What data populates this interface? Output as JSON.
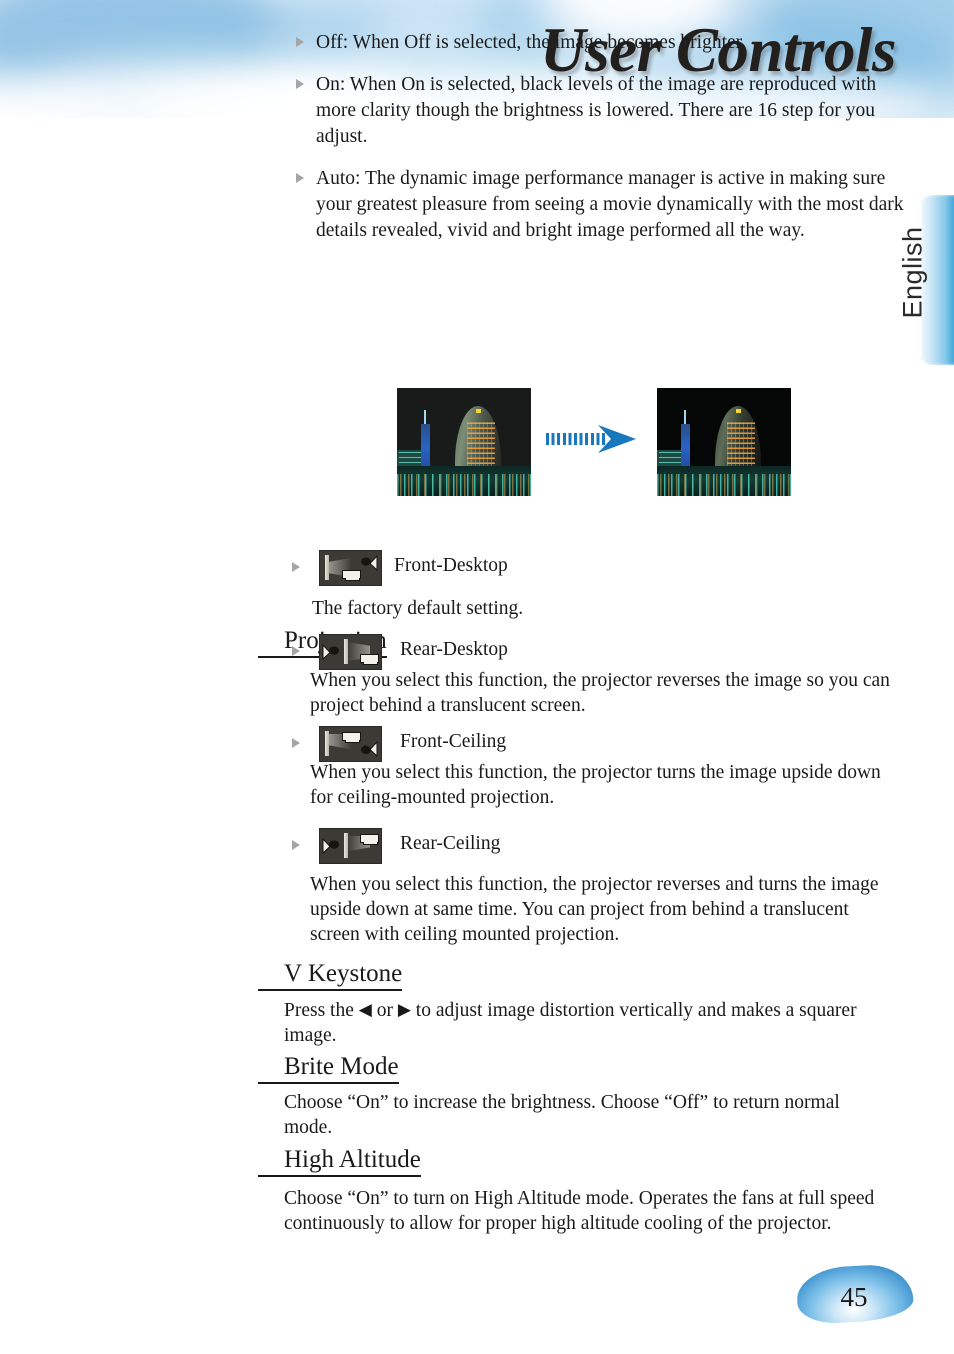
{
  "header": {
    "title": "User Controls"
  },
  "side_tab": {
    "label": "English"
  },
  "intro_bullets": [
    {
      "text": "Off: When Off is selected, the image becomes brighter."
    },
    {
      "text": "On: When On is selected, black levels of the image are reproduced with more clarity though the brightness is lowered. There are 16 step for you adjust."
    },
    {
      "text": "Auto: The dynamic image performance manager is active in making sure your greatest pleasure from seeing a movie dynamically with the most dark details revealed, vivid and bright image performed all the way."
    }
  ],
  "comparison": {
    "left_image_alt": "night-cityscape-normal",
    "right_image_alt": "night-cityscape-dynamic-black",
    "arrow_icon": "right-arrow-icon",
    "arrow_color": "#1878be"
  },
  "sections": [
    {
      "id": "projection",
      "heading": "Projection",
      "items": [
        {
          "icon": "front-desktop-projection-icon",
          "label": "Front-Desktop",
          "description": "The factory default setting."
        },
        {
          "icon": "rear-desktop-projection-icon",
          "label": "Rear-Desktop",
          "description": "When you select this function, the projector reverses the image so you can project behind a translucent screen."
        },
        {
          "icon": "front-ceiling-projection-icon",
          "label": "Front-Ceiling",
          "description": "When you select this function, the projector turns the image upside down for ceiling-mounted projection."
        },
        {
          "icon": "rear-ceiling-projection-icon",
          "label": "Rear-Ceiling",
          "description": "When you select this function, the projector reverses and turns the image upside down at same time. You can project from behind a translucent screen with ceiling mounted projection."
        }
      ]
    },
    {
      "id": "v-keystone",
      "heading": "V Keystone",
      "body_pre": "Press the ",
      "body_mid": " or ",
      "body_post": " to adjust image distortion vertically and makes a squarer image.",
      "left_arrow": "◀",
      "right_arrow": "▶"
    },
    {
      "id": "brite-mode",
      "heading": "Brite Mode",
      "body": "Choose “On” to increase the brightness. Choose “Off” to return normal mode."
    },
    {
      "id": "high-altitude",
      "heading": "High Altitude",
      "body": "Choose “On” to turn on High Altitude mode. Operates the fans at full speed continuously to allow for proper high altitude cooling of the projector."
    }
  ],
  "footer": {
    "page_number": "45"
  }
}
